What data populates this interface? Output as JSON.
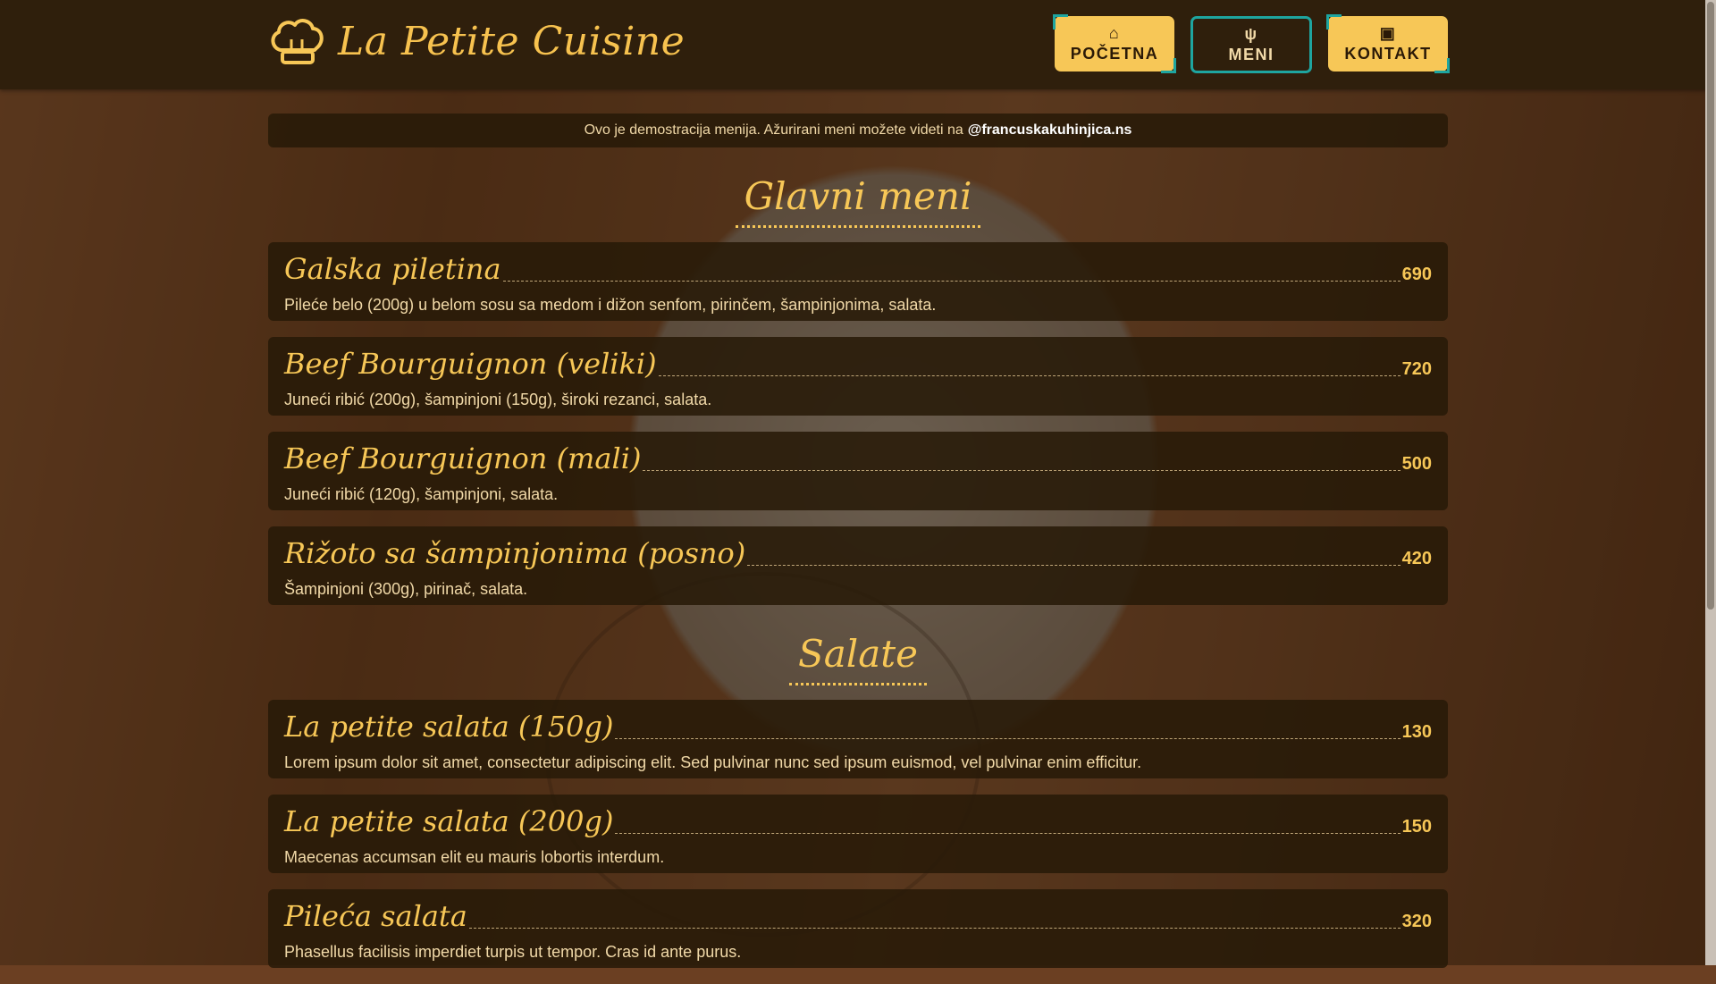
{
  "brand": {
    "name": "La Petite Cuisine",
    "icon": "chef-hat-icon"
  },
  "nav": [
    {
      "label": "POČETNA",
      "icon": "home-icon",
      "active": false
    },
    {
      "label": "MENI",
      "icon": "fork-knife-icon",
      "active": true
    },
    {
      "label": "KONTAKT",
      "icon": "contact-icon",
      "active": false
    }
  ],
  "notice": {
    "text": "Ovo je demostracija menija. Ažurirani meni možete videti na",
    "handle": "@francuskakuhinjica.ns"
  },
  "sections": [
    {
      "title": "Glavni meni",
      "items": [
        {
          "name": "Galska piletina",
          "price": "690",
          "desc": "Pileće belo (200g) u belom sosu sa medom i dižon senfom, pirinčem, šampinjonima, salata."
        },
        {
          "name": "Beef Bourguignon (veliki)",
          "price": "720",
          "desc": "Juneći ribić (200g), šampinjoni (150g), široki rezanci, salata."
        },
        {
          "name": "Beef Bourguignon (mali)",
          "price": "500",
          "desc": "Juneći ribić (120g), šampinjoni, salata."
        },
        {
          "name": "Rižoto sa šampinjonima (posno)",
          "price": "420",
          "desc": "Šampinjoni (300g), pirinač, salata."
        }
      ]
    },
    {
      "title": "Salate",
      "items": [
        {
          "name": "La petite salata (150g)",
          "price": "130",
          "desc": "Lorem ipsum dolor sit amet, consectetur adipiscing elit. Sed pulvinar nunc sed ipsum euismod, vel pulvinar enim efficitur."
        },
        {
          "name": "La petite salata (200g)",
          "price": "150",
          "desc": "Maecenas accumsan elit eu mauris lobortis interdum."
        },
        {
          "name": "Pileća salata",
          "price": "320",
          "desc": "Phasellus facilisis imperdiet turpis ut tempor. Cras id ante purus."
        }
      ]
    }
  ],
  "colors": {
    "accent": "#f7c757",
    "header_bg": "#2f1f0c",
    "focus_ring": "#1ea5a0"
  }
}
